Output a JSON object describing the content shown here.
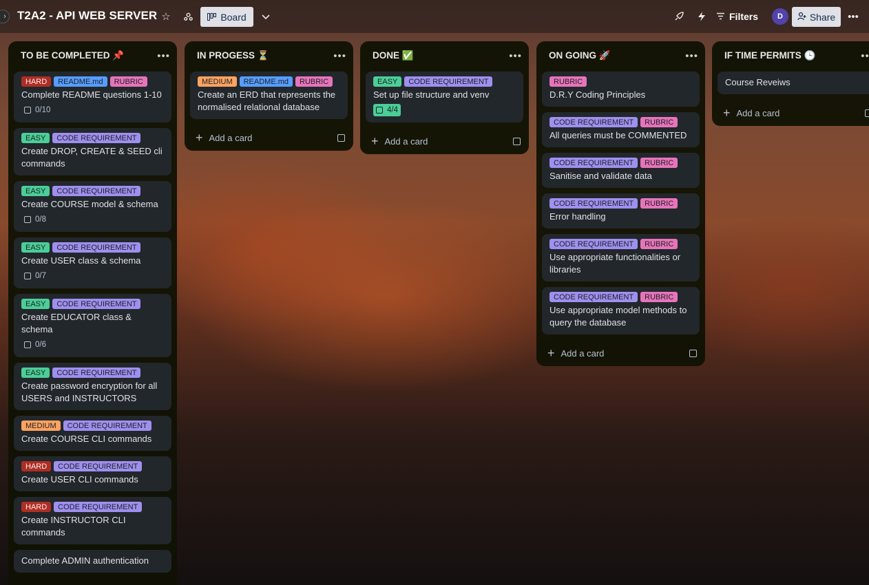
{
  "board": {
    "title": "T2A2 - API WEB SERVER",
    "view_label": "Board",
    "filters_label": "Filters",
    "share_label": "Share",
    "avatar_initial": "D"
  },
  "icons": {
    "star": "star-icon",
    "workspace": "workspace-visibility-icon",
    "board_view": "board-view-icon",
    "chevron": "chevron-down-icon",
    "power_up": "rocket-icon",
    "automation": "lightning-icon",
    "filter": "filter-icon",
    "share": "add-person-icon",
    "more": "more-icon"
  },
  "lists": [
    {
      "title": "TO BE COMPLETED 📌",
      "add_label": "Add a card",
      "cards": [
        {
          "labels": [
            {
              "text": "HARD",
              "kind": "hard"
            },
            {
              "text": "README.md",
              "kind": "readme"
            },
            {
              "text": "RUBRIC",
              "kind": "rubric"
            }
          ],
          "title": "Complete README questions 1-10",
          "checklist": "0/10"
        },
        {
          "labels": [
            {
              "text": "EASY",
              "kind": "easy"
            },
            {
              "text": "CODE REQUIREMENT",
              "kind": "code"
            }
          ],
          "title": "Create DROP, CREATE & SEED cli commands"
        },
        {
          "labels": [
            {
              "text": "EASY",
              "kind": "easy"
            },
            {
              "text": "CODE REQUIREMENT",
              "kind": "code"
            }
          ],
          "title": "Create COURSE model & schema",
          "checklist": "0/8"
        },
        {
          "labels": [
            {
              "text": "EASY",
              "kind": "easy"
            },
            {
              "text": "CODE REQUIREMENT",
              "kind": "code"
            }
          ],
          "title": "Create USER class & schema",
          "checklist": "0/7"
        },
        {
          "labels": [
            {
              "text": "EASY",
              "kind": "easy"
            },
            {
              "text": "CODE REQUIREMENT",
              "kind": "code"
            }
          ],
          "title": "Create EDUCATOR class & schema",
          "checklist": "0/6"
        },
        {
          "labels": [
            {
              "text": "EASY",
              "kind": "easy"
            },
            {
              "text": "CODE REQUIREMENT",
              "kind": "code"
            }
          ],
          "title": "Create password encryption for all USERS and INSTRUCTORS"
        },
        {
          "labels": [
            {
              "text": "MEDIUM",
              "kind": "medium"
            },
            {
              "text": "CODE REQUIREMENT",
              "kind": "code"
            }
          ],
          "title": "Create COURSE CLI commands"
        },
        {
          "labels": [
            {
              "text": "HARD",
              "kind": "hard"
            },
            {
              "text": "CODE REQUIREMENT",
              "kind": "code"
            }
          ],
          "title": "Create USER CLI commands"
        },
        {
          "labels": [
            {
              "text": "HARD",
              "kind": "hard"
            },
            {
              "text": "CODE REQUIREMENT",
              "kind": "code"
            }
          ],
          "title": "Create INSTRUCTOR CLI commands"
        },
        {
          "labels": [],
          "title": "Complete ADMIN authentication"
        }
      ]
    },
    {
      "title": "IN PROGESS ⏳",
      "add_label": "Add a card",
      "cards": [
        {
          "labels": [
            {
              "text": "MEDIUM",
              "kind": "medium"
            },
            {
              "text": "README.md",
              "kind": "readme"
            },
            {
              "text": "RUBRIC",
              "kind": "rubric"
            }
          ],
          "title": "Create an ERD that represents the normalised relational database"
        }
      ]
    },
    {
      "title": "DONE ✅",
      "add_label": "Add a card",
      "cards": [
        {
          "labels": [
            {
              "text": "EASY",
              "kind": "easy"
            },
            {
              "text": "CODE REQUIREMENT",
              "kind": "code"
            }
          ],
          "title": "Set up file structure and venv",
          "checklist": "4/4",
          "checklist_done": true
        }
      ]
    },
    {
      "title": "ON GOING 🚀",
      "add_label": "Add a card",
      "cards": [
        {
          "labels": [
            {
              "text": "RUBRIC",
              "kind": "rubric"
            }
          ],
          "title": "D.R.Y Coding Principles"
        },
        {
          "labels": [
            {
              "text": "CODE REQUIREMENT",
              "kind": "code"
            },
            {
              "text": "RUBRIC",
              "kind": "rubric"
            }
          ],
          "title": "All queries must be COMMENTED"
        },
        {
          "labels": [
            {
              "text": "CODE REQUIREMENT",
              "kind": "code"
            },
            {
              "text": "RUBRIC",
              "kind": "rubric"
            }
          ],
          "title": "Sanitise and validate data"
        },
        {
          "labels": [
            {
              "text": "CODE REQUIREMENT",
              "kind": "code"
            },
            {
              "text": "RUBRIC",
              "kind": "rubric"
            }
          ],
          "title": "Error handling"
        },
        {
          "labels": [
            {
              "text": "CODE REQUIREMENT",
              "kind": "code"
            },
            {
              "text": "RUBRIC",
              "kind": "rubric"
            }
          ],
          "title": "Use appropriate functionalities or libraries"
        },
        {
          "labels": [
            {
              "text": "CODE REQUIREMENT",
              "kind": "code"
            },
            {
              "text": "RUBRIC",
              "kind": "rubric"
            }
          ],
          "title": "Use appropriate model methods to query the database"
        }
      ]
    },
    {
      "title": "IF TIME PERMITS 🕒",
      "add_label": "Add a card",
      "cards": [
        {
          "labels": [],
          "title": "Course Reveiws"
        }
      ]
    }
  ]
}
